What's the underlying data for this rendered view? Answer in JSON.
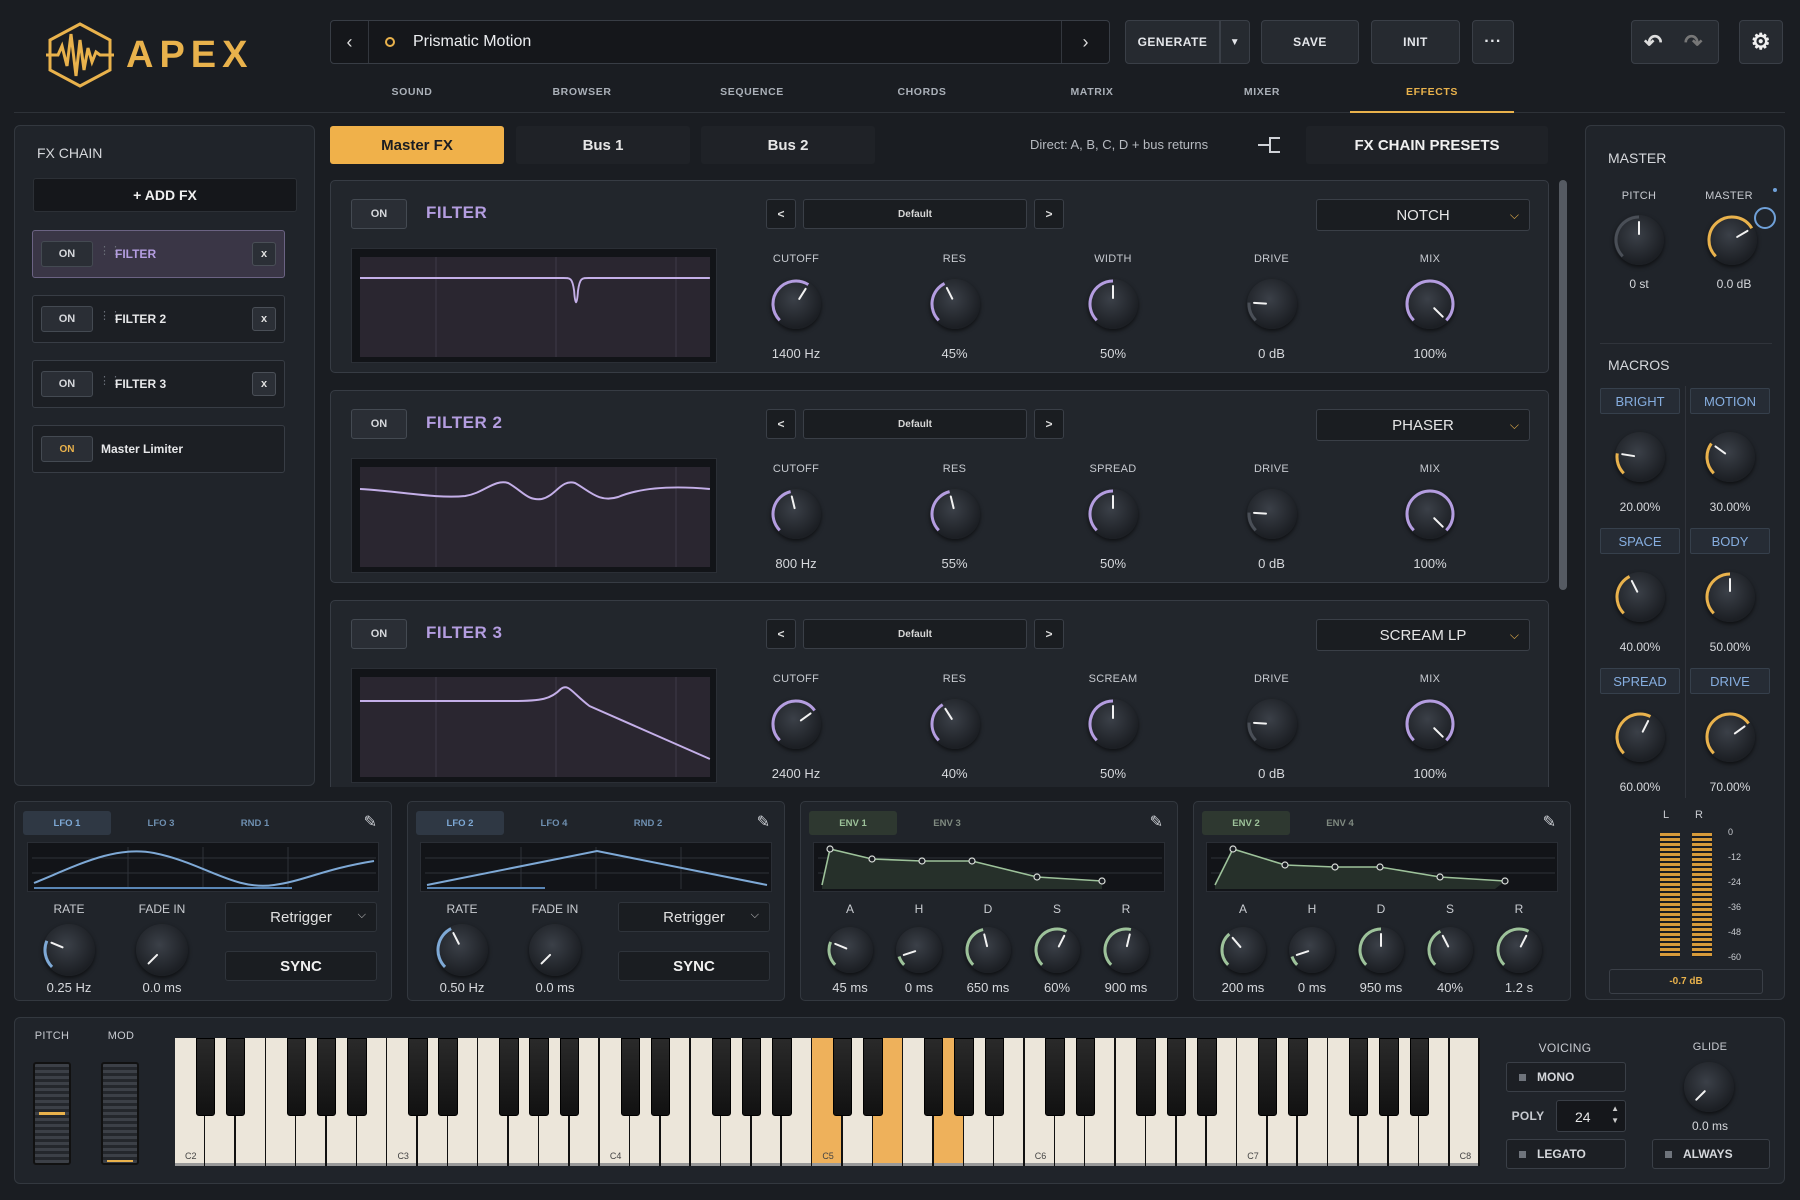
{
  "header": {
    "logo_text": "APEX",
    "preset_name": "Prismatic Motion",
    "generate_label": "GENERATE",
    "save_label": "SAVE",
    "init_label": "INIT",
    "more_label": "···"
  },
  "tabs": [
    {
      "label": "SOUND"
    },
    {
      "label": "BROWSER"
    },
    {
      "label": "SEQUENCE"
    },
    {
      "label": "CHORDS"
    },
    {
      "label": "MATRIX"
    },
    {
      "label": "MIXER"
    },
    {
      "label": "EFFECTS"
    }
  ],
  "fx_chain": {
    "title": "FX CHAIN",
    "add_label": "+ ADD FX",
    "items": [
      {
        "on": "ON",
        "name": "FILTER",
        "remove": "x"
      },
      {
        "on": "ON",
        "name": "FILTER 2",
        "remove": "x"
      },
      {
        "on": "ON",
        "name": "FILTER 3",
        "remove": "x"
      },
      {
        "on": "ON",
        "name": "Master Limiter"
      }
    ]
  },
  "bus_tabs": [
    {
      "label": "Master FX"
    },
    {
      "label": "Bus 1"
    },
    {
      "label": "Bus 2"
    }
  ],
  "routing_text": "Direct: A, B, C, D + bus returns",
  "fx_presets_label": "FX CHAIN PRESETS",
  "sections": [
    {
      "on": "ON",
      "name": "FILTER",
      "preset": "Default",
      "prev": "<",
      "next": ">",
      "mode": "NOTCH",
      "params": [
        {
          "label": "CUTOFF",
          "value": "1400 Hz"
        },
        {
          "label": "RES",
          "value": "45%"
        },
        {
          "label": "WIDTH",
          "value": "50%"
        },
        {
          "label": "DRIVE",
          "value": "0 dB"
        },
        {
          "label": "MIX",
          "value": "100%"
        }
      ]
    },
    {
      "on": "ON",
      "name": "FILTER 2",
      "preset": "Default",
      "prev": "<",
      "next": ">",
      "mode": "PHASER",
      "params": [
        {
          "label": "CUTOFF",
          "value": "800 Hz"
        },
        {
          "label": "RES",
          "value": "55%"
        },
        {
          "label": "SPREAD",
          "value": "50%"
        },
        {
          "label": "DRIVE",
          "value": "0 dB"
        },
        {
          "label": "MIX",
          "value": "100%"
        }
      ]
    },
    {
      "on": "ON",
      "name": "FILTER 3",
      "preset": "Default",
      "prev": "<",
      "next": ">",
      "mode": "SCREAM LP",
      "params": [
        {
          "label": "CUTOFF",
          "value": "2400 Hz"
        },
        {
          "label": "RES",
          "value": "40%"
        },
        {
          "label": "SCREAM",
          "value": "50%"
        },
        {
          "label": "DRIVE",
          "value": "0 dB"
        },
        {
          "label": "MIX",
          "value": "100%"
        }
      ]
    }
  ],
  "master": {
    "title": "MASTER",
    "pitch_label": "PITCH",
    "pitch_value": "0 st",
    "master_label": "MASTER",
    "master_value": "0.0 dB"
  },
  "macros": {
    "title": "MACROS",
    "items": [
      {
        "label": "BRIGHT",
        "value": "20.00%"
      },
      {
        "label": "MOTION",
        "value": "30.00%"
      },
      {
        "label": "SPACE",
        "value": "40.00%"
      },
      {
        "label": "BODY",
        "value": "50.00%"
      },
      {
        "label": "SPREAD",
        "value": "60.00%"
      },
      {
        "label": "DRIVE",
        "value": "70.00%"
      }
    ]
  },
  "meter": {
    "l": "L",
    "r": "R",
    "scale": [
      "0",
      "-12",
      "-24",
      "-36",
      "-48",
      "-60"
    ],
    "readout": "-0.7 dB"
  },
  "modulators": [
    {
      "tabs": [
        "LFO 1",
        "LFO 3",
        "RND 1"
      ],
      "rate_label": "RATE",
      "rate_value": "0.25 Hz",
      "fade_label": "FADE IN",
      "fade_value": "0.0 ms",
      "retrigger": "Retrigger",
      "sync": "SYNC"
    },
    {
      "tabs": [
        "LFO 2",
        "LFO 4",
        "RND 2"
      ],
      "rate_label": "RATE",
      "rate_value": "0.50 Hz",
      "fade_label": "FADE IN",
      "fade_value": "0.0 ms",
      "retrigger": "Retrigger",
      "sync": "SYNC"
    }
  ],
  "envelopes": [
    {
      "tabs": [
        "ENV 1",
        "ENV 3"
      ],
      "params": [
        {
          "label": "A",
          "value": "45 ms"
        },
        {
          "label": "H",
          "value": "0 ms"
        },
        {
          "label": "D",
          "value": "650 ms"
        },
        {
          "label": "S",
          "value": "60%"
        },
        {
          "label": "R",
          "value": "900 ms"
        }
      ]
    },
    {
      "tabs": [
        "ENV 2",
        "ENV 4"
      ],
      "params": [
        {
          "label": "A",
          "value": "200 ms"
        },
        {
          "label": "H",
          "value": "0 ms"
        },
        {
          "label": "D",
          "value": "950 ms"
        },
        {
          "label": "S",
          "value": "40%"
        },
        {
          "label": "R",
          "value": "1.2 s"
        }
      ]
    }
  ],
  "keyboard": {
    "pitch_label": "PITCH",
    "mod_label": "MOD",
    "octave_labels": [
      "C2",
      "C3",
      "C4",
      "C5",
      "C6",
      "C7",
      "C8"
    ]
  },
  "voicing": {
    "title": "VOICING",
    "mono": "MONO",
    "poly_label": "POLY",
    "poly_value": "24",
    "legato": "LEGATO",
    "glide_label": "GLIDE",
    "glide_value": "0.0 ms",
    "always": "ALWAYS"
  },
  "colors": {
    "accent": "#e9b24c",
    "filter_purple": "#b49de0",
    "lfo_blue": "#7ea9d6",
    "env_green": "#9dc29a"
  }
}
